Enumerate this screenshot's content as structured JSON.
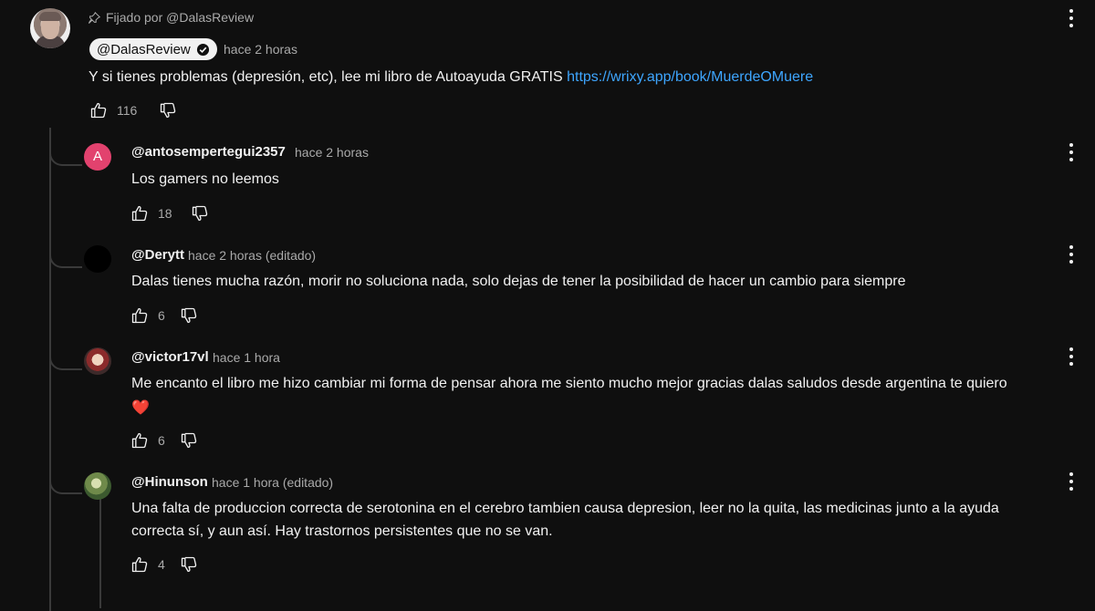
{
  "pinned": {
    "pinned_label": "Fijado por @DalasReview",
    "author": "@DalasReview",
    "time": "hace 2 horas",
    "text": "Y si tienes problemas (depresión, etc), lee mi libro de Autoayuda GRATIS ",
    "link": "https://wrixy.app/book/MuerdeOMuere",
    "likes": "116"
  },
  "replies": [
    {
      "author": "@antosempertegui2357",
      "time": "hace 2 horas",
      "avatar_letter": "A",
      "text": "Los gamers no leemos",
      "likes": "18"
    },
    {
      "author": "@Derytt",
      "time": "hace 2 horas (editado)",
      "text": "Dalas tienes mucha razón, morir no soluciona nada, solo dejas de tener la posibilidad de hacer un cambio para siempre",
      "likes": "6"
    },
    {
      "author": "@victor17vl",
      "time": "hace 1 hora",
      "text": "Me encanto el libro me hizo cambiar  mi forma de pensar ahora me siento mucho mejor gracias dalas saludos desde argentina te quiero",
      "emoji": "❤️",
      "likes": "6"
    },
    {
      "author": "@Hinunson",
      "time": "hace 1 hora (editado)",
      "text_line1": "Una falta de produccion correcta de serotonina en el cerebro tambien causa depresion, leer no la quita, las medicinas junto a la ayuda",
      "text_line2": "correcta sí, y aun así. Hay trastornos persistentes que no se van.",
      "likes": "4"
    }
  ],
  "icons": {
    "pin": "pin-icon",
    "verified": "verified-check-icon",
    "like": "thumbs-up-icon",
    "dislike": "thumbs-down-icon",
    "menu": "more-vert-icon"
  },
  "colors": {
    "background": "#0f0f0f",
    "text": "#f1f1f1",
    "muted": "#aaaaaa",
    "link": "#3ea6ff",
    "avatar_a": "#e2426e"
  }
}
